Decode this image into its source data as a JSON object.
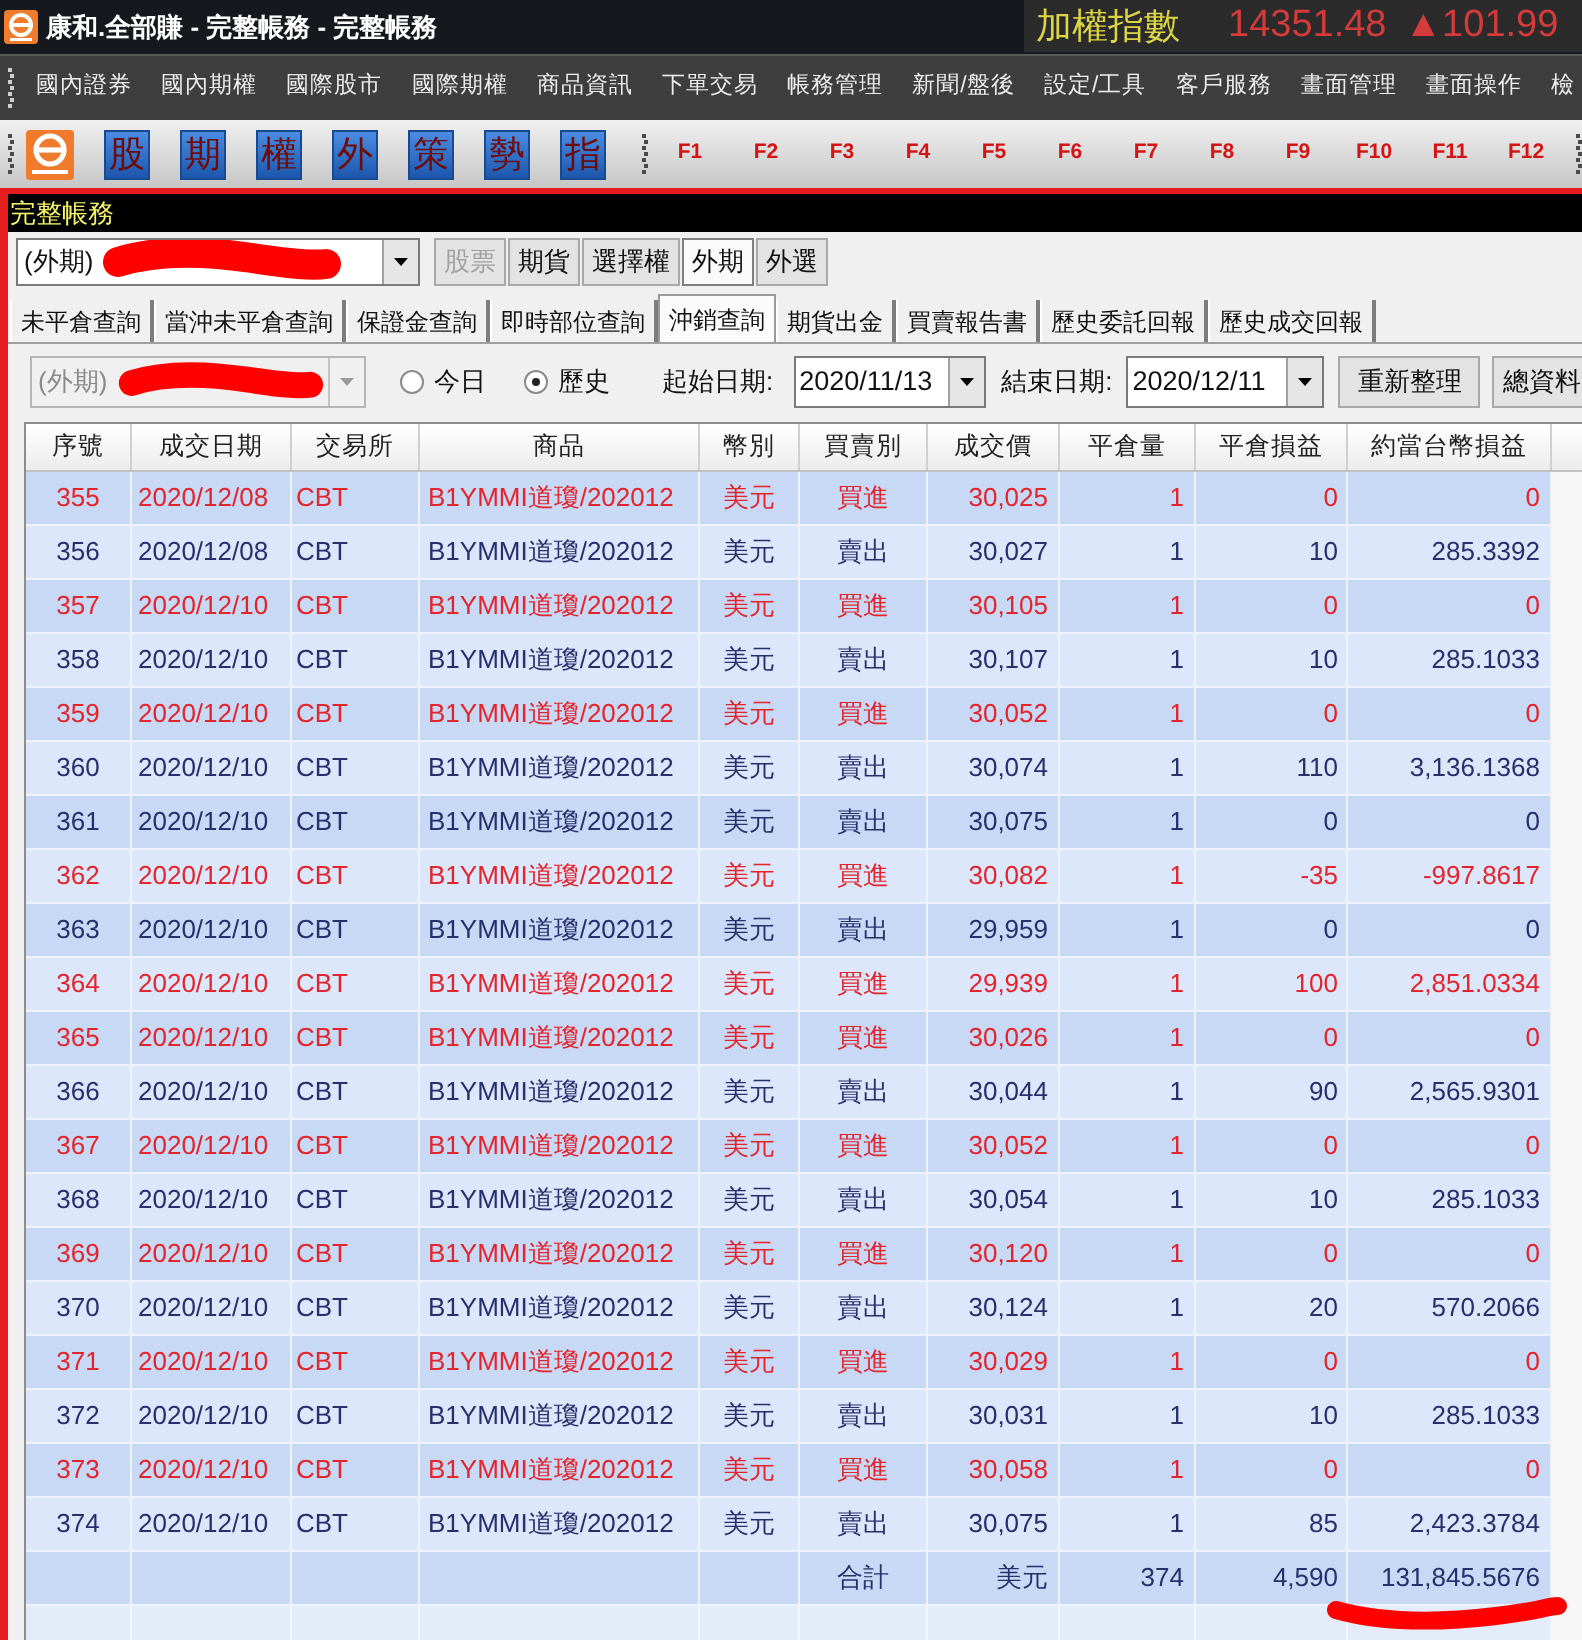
{
  "window": {
    "title": "康和.全部賺 - 完整帳務 - 完整帳務"
  },
  "ticker": {
    "label": "加權指數",
    "value": "14351.48",
    "change": "▲101.99"
  },
  "menu": [
    "國內證券",
    "國內期權",
    "國際股市",
    "國際期權",
    "商品資訊",
    "下單交易",
    "帳務管理",
    "新聞/盤後",
    "設定/工具",
    "客戶服務",
    "畫面管理",
    "畫面操作",
    "檢"
  ],
  "toolbar": {
    "quick_buttons": [
      "股",
      "期",
      "權",
      "外",
      "策",
      "勢",
      "指"
    ],
    "function_keys": [
      "F1",
      "F2",
      "F3",
      "F4",
      "F5",
      "F6",
      "F7",
      "F8",
      "F9",
      "F10",
      "F11",
      "F12"
    ]
  },
  "panel": {
    "title": "完整帳務"
  },
  "account_bar": {
    "account": {
      "value": "(外期)",
      "disabled": false
    },
    "market_buttons": [
      {
        "label": "股票",
        "disabled": true,
        "selected": false
      },
      {
        "label": "期貨",
        "disabled": false,
        "selected": false
      },
      {
        "label": "選擇權",
        "disabled": false,
        "selected": false
      },
      {
        "label": "外期",
        "disabled": false,
        "selected": true
      },
      {
        "label": "外選",
        "disabled": false,
        "selected": false
      }
    ]
  },
  "query_tabs": [
    {
      "label": "未平倉查詢",
      "selected": false
    },
    {
      "label": "當沖未平倉查詢",
      "selected": false
    },
    {
      "label": "保證金查詢",
      "selected": false
    },
    {
      "label": "即時部位查詢",
      "selected": false
    },
    {
      "label": "沖銷查詢",
      "selected": true
    },
    {
      "label": "期貨出金",
      "selected": false
    },
    {
      "label": "買賣報告書",
      "selected": false
    },
    {
      "label": "歷史委託回報",
      "selected": false
    },
    {
      "label": "歷史成交回報",
      "selected": false
    }
  ],
  "filters": {
    "account": {
      "value": "(外期)",
      "disabled": true
    },
    "range_options": [
      {
        "label": "今日",
        "selected": false
      },
      {
        "label": "歷史",
        "selected": true
      }
    ],
    "start_date": {
      "label": "起始日期:",
      "value": "2020/11/13"
    },
    "end_date": {
      "label": "結束日期:",
      "value": "2020/12/11"
    },
    "buttons": [
      "重新整理",
      "總資料"
    ]
  },
  "table": {
    "columns": [
      "序號",
      "成交日期",
      "交易所",
      "商品",
      "幣別",
      "買賣別",
      "成交價",
      "平倉量",
      "平倉損益",
      "約當台幣損益"
    ],
    "rows": [
      {
        "kind": "buy",
        "cells": [
          "355",
          "2020/12/08",
          "CBT",
          "B1YMMI道瓊/202012",
          "美元",
          "買進",
          "30,025",
          "1",
          "0",
          "0"
        ]
      },
      {
        "kind": "sell",
        "cells": [
          "356",
          "2020/12/08",
          "CBT",
          "B1YMMI道瓊/202012",
          "美元",
          "賣出",
          "30,027",
          "1",
          "10",
          "285.3392"
        ]
      },
      {
        "kind": "buy",
        "cells": [
          "357",
          "2020/12/10",
          "CBT",
          "B1YMMI道瓊/202012",
          "美元",
          "買進",
          "30,105",
          "1",
          "0",
          "0"
        ]
      },
      {
        "kind": "sell",
        "cells": [
          "358",
          "2020/12/10",
          "CBT",
          "B1YMMI道瓊/202012",
          "美元",
          "賣出",
          "30,107",
          "1",
          "10",
          "285.1033"
        ]
      },
      {
        "kind": "buy",
        "cells": [
          "359",
          "2020/12/10",
          "CBT",
          "B1YMMI道瓊/202012",
          "美元",
          "買進",
          "30,052",
          "1",
          "0",
          "0"
        ]
      },
      {
        "kind": "sell",
        "cells": [
          "360",
          "2020/12/10",
          "CBT",
          "B1YMMI道瓊/202012",
          "美元",
          "賣出",
          "30,074",
          "1",
          "110",
          "3,136.1368"
        ]
      },
      {
        "kind": "sell",
        "cells": [
          "361",
          "2020/12/10",
          "CBT",
          "B1YMMI道瓊/202012",
          "美元",
          "賣出",
          "30,075",
          "1",
          "0",
          "0"
        ]
      },
      {
        "kind": "buy",
        "cells": [
          "362",
          "2020/12/10",
          "CBT",
          "B1YMMI道瓊/202012",
          "美元",
          "買進",
          "30,082",
          "1",
          "-35",
          "-997.8617"
        ]
      },
      {
        "kind": "sell",
        "cells": [
          "363",
          "2020/12/10",
          "CBT",
          "B1YMMI道瓊/202012",
          "美元",
          "賣出",
          "29,959",
          "1",
          "0",
          "0"
        ]
      },
      {
        "kind": "buy",
        "cells": [
          "364",
          "2020/12/10",
          "CBT",
          "B1YMMI道瓊/202012",
          "美元",
          "買進",
          "29,939",
          "1",
          "100",
          "2,851.0334"
        ]
      },
      {
        "kind": "buy",
        "cells": [
          "365",
          "2020/12/10",
          "CBT",
          "B1YMMI道瓊/202012",
          "美元",
          "買進",
          "30,026",
          "1",
          "0",
          "0"
        ]
      },
      {
        "kind": "sell",
        "cells": [
          "366",
          "2020/12/10",
          "CBT",
          "B1YMMI道瓊/202012",
          "美元",
          "賣出",
          "30,044",
          "1",
          "90",
          "2,565.9301"
        ]
      },
      {
        "kind": "buy",
        "cells": [
          "367",
          "2020/12/10",
          "CBT",
          "B1YMMI道瓊/202012",
          "美元",
          "買進",
          "30,052",
          "1",
          "0",
          "0"
        ]
      },
      {
        "kind": "sell",
        "cells": [
          "368",
          "2020/12/10",
          "CBT",
          "B1YMMI道瓊/202012",
          "美元",
          "賣出",
          "30,054",
          "1",
          "10",
          "285.1033"
        ]
      },
      {
        "kind": "buy",
        "cells": [
          "369",
          "2020/12/10",
          "CBT",
          "B1YMMI道瓊/202012",
          "美元",
          "買進",
          "30,120",
          "1",
          "0",
          "0"
        ]
      },
      {
        "kind": "sell",
        "cells": [
          "370",
          "2020/12/10",
          "CBT",
          "B1YMMI道瓊/202012",
          "美元",
          "賣出",
          "30,124",
          "1",
          "20",
          "570.2066"
        ]
      },
      {
        "kind": "buy",
        "cells": [
          "371",
          "2020/12/10",
          "CBT",
          "B1YMMI道瓊/202012",
          "美元",
          "買進",
          "30,029",
          "1",
          "0",
          "0"
        ]
      },
      {
        "kind": "sell",
        "cells": [
          "372",
          "2020/12/10",
          "CBT",
          "B1YMMI道瓊/202012",
          "美元",
          "賣出",
          "30,031",
          "1",
          "10",
          "285.1033"
        ]
      },
      {
        "kind": "buy",
        "cells": [
          "373",
          "2020/12/10",
          "CBT",
          "B1YMMI道瓊/202012",
          "美元",
          "買進",
          "30,058",
          "1",
          "0",
          "0"
        ]
      },
      {
        "kind": "sell",
        "cells": [
          "374",
          "2020/12/10",
          "CBT",
          "B1YMMI道瓊/202012",
          "美元",
          "賣出",
          "30,075",
          "1",
          "85",
          "2,423.3784"
        ]
      }
    ],
    "total": {
      "label": "合計",
      "currency": "美元",
      "quantity": "374",
      "pnl": "4,590",
      "twd_pnl": "131,845.5676"
    }
  }
}
